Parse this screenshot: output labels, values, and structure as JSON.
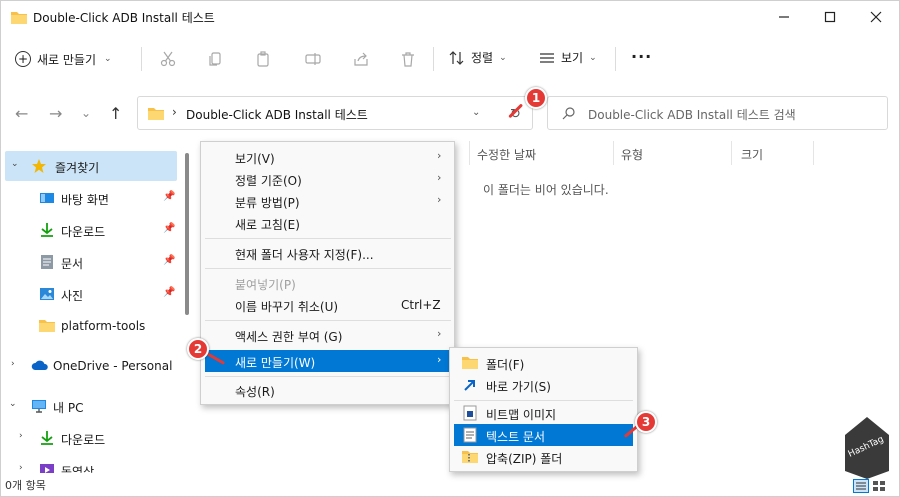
{
  "window": {
    "title": "Double-Click ADB Install 테스트"
  },
  "toolbar": {
    "new_label": "새로 만들기",
    "sort_label": "정렬",
    "view_label": "보기"
  },
  "address": {
    "path": "Double-Click ADB Install 테스트"
  },
  "search": {
    "placeholder": "Double-Click ADB Install 테스트 검색"
  },
  "sidebar": {
    "items": [
      {
        "label": "즐겨찾기"
      },
      {
        "label": "바탕 화면"
      },
      {
        "label": "다운로드"
      },
      {
        "label": "문서"
      },
      {
        "label": "사진"
      },
      {
        "label": "platform-tools"
      },
      {
        "label": "OneDrive - Personal"
      },
      {
        "label": "내 PC"
      },
      {
        "label": "다운로드"
      },
      {
        "label": "동영상"
      }
    ]
  },
  "columns": {
    "modified": "수정한 날짜",
    "type": "유형",
    "size": "크기"
  },
  "content": {
    "empty_message": "이 폴더는 비어 있습니다."
  },
  "context_menu": {
    "items": [
      {
        "label": "보기(V)"
      },
      {
        "label": "정렬 기준(O)"
      },
      {
        "label": "분류 방법(P)"
      },
      {
        "label": "새로 고침(E)"
      },
      {
        "label": "현재 폴더 사용자 지정(F)..."
      },
      {
        "label": "붙여넣기(P)"
      },
      {
        "label": "이름 바꾸기 취소(U)",
        "shortcut": "Ctrl+Z"
      },
      {
        "label": "액세스 권한 부여 (G)"
      },
      {
        "label": "새로 만들기(W)"
      },
      {
        "label": "속성(R)"
      }
    ]
  },
  "submenu": {
    "items": [
      {
        "label": "폴더(F)"
      },
      {
        "label": "바로 가기(S)"
      },
      {
        "label": "비트맵 이미지"
      },
      {
        "label": "텍스트 문서"
      },
      {
        "label": "압축(ZIP) 폴더"
      }
    ]
  },
  "markers": [
    "1",
    "2",
    "3"
  ],
  "status": {
    "count": "0개 항목"
  },
  "watermark": {
    "text": "HashTag"
  },
  "colors": {
    "accent": "#0078d4",
    "selection": "#cce4f7",
    "marker": "#e53935",
    "folder": "#f8c14a"
  }
}
